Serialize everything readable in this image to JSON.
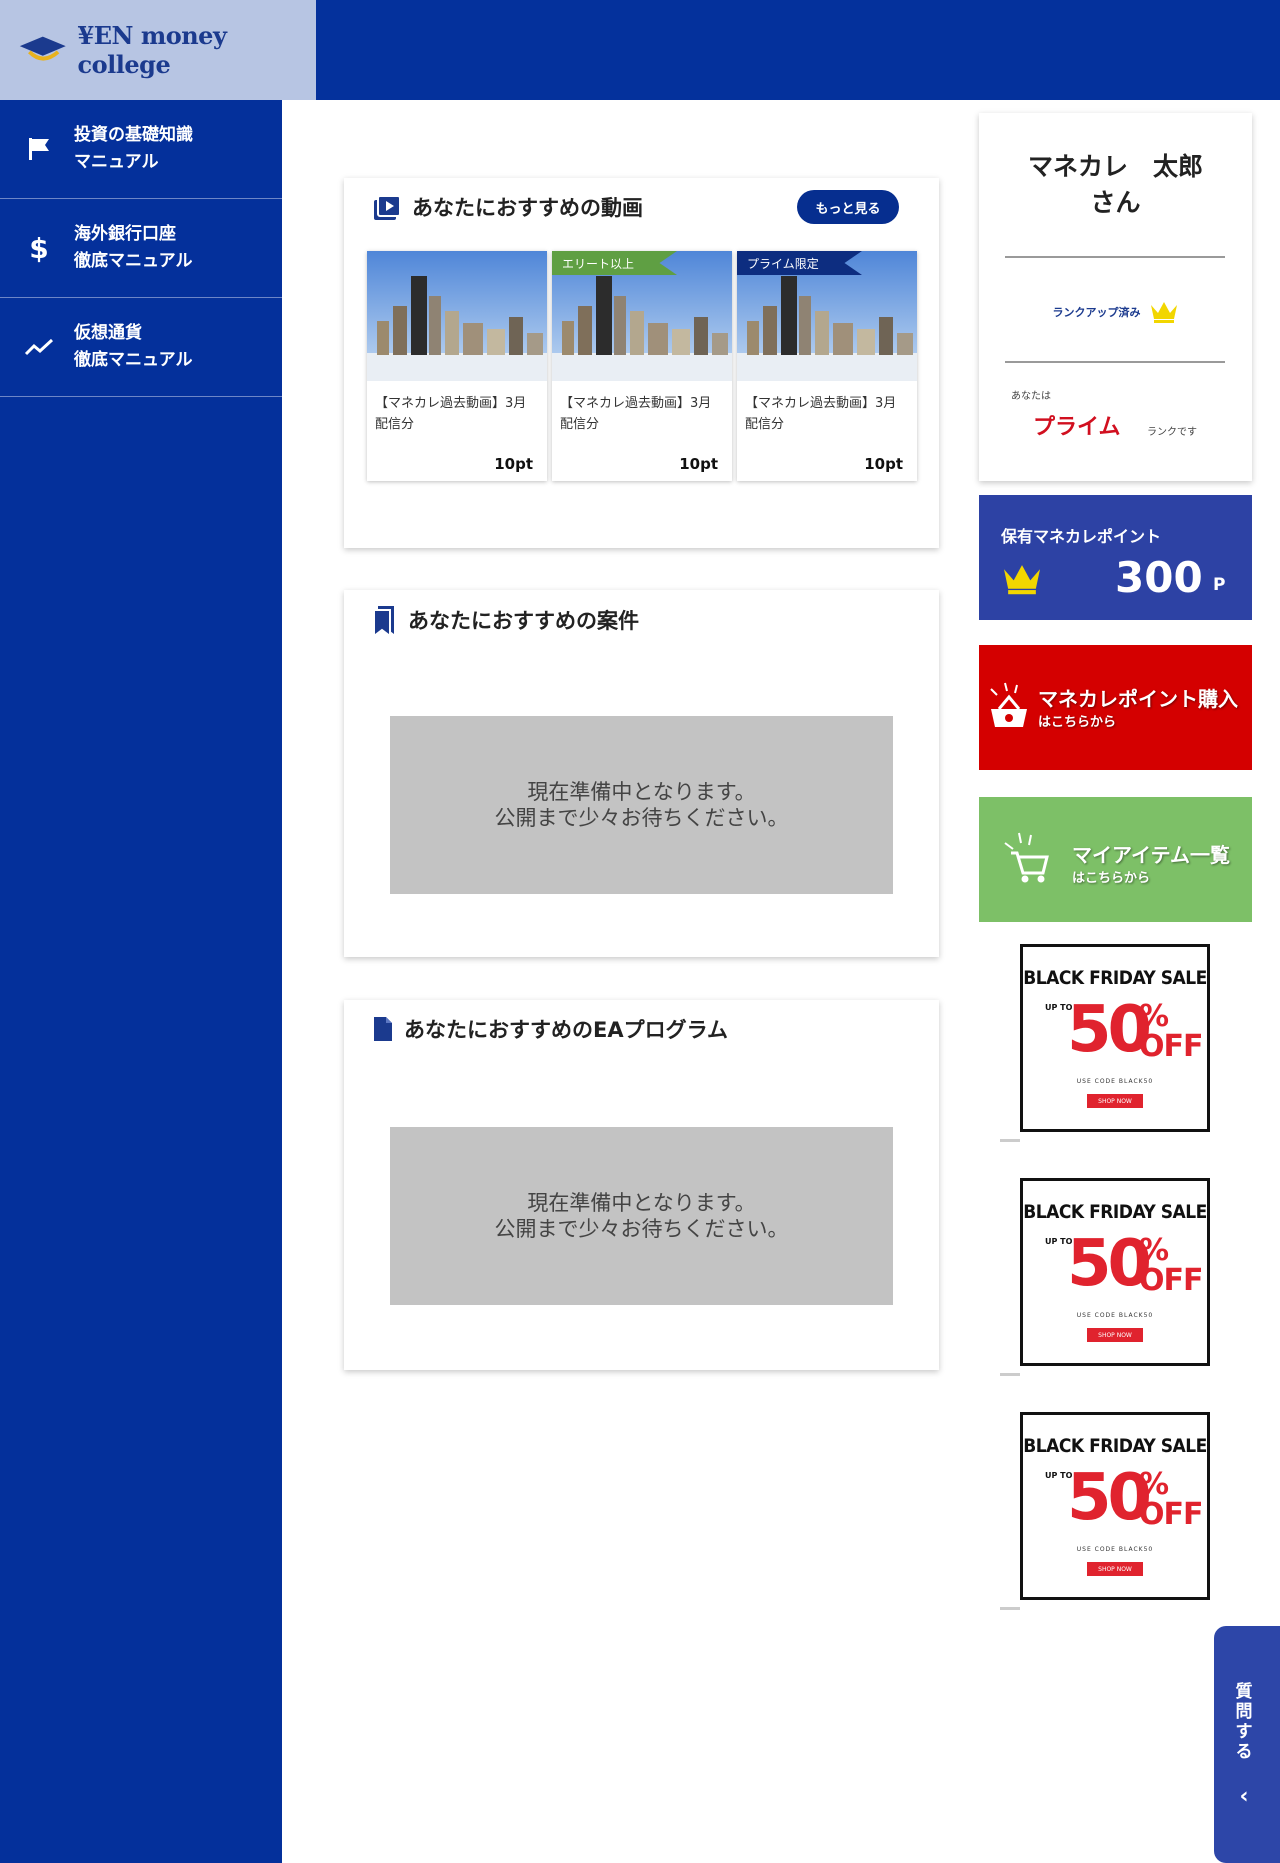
{
  "brand": {
    "logo_text": "¥EN money college"
  },
  "sidebar": {
    "items": [
      {
        "icon": "flag-icon",
        "label": "投資の基礎知識\nマニュアル"
      },
      {
        "icon": "dollar-icon",
        "label": "海外銀行口座\n徹底マニュアル"
      },
      {
        "icon": "trend-icon",
        "label": "仮想通貨\n徹底マニュアル"
      }
    ]
  },
  "videos_section": {
    "title": "あなたにおすすめの動画",
    "more_label": "もっと見る",
    "videos": [
      {
        "title": "【マネカレ過去動画】3月配信分",
        "points": "10pt",
        "ribbon": ""
      },
      {
        "title": "【マネカレ過去動画】3月配信分",
        "points": "10pt",
        "ribbon": "エリート以上"
      },
      {
        "title": "【マネカレ過去動画】3月配信分",
        "points": "10pt",
        "ribbon": "プライム限定"
      }
    ]
  },
  "deals_section": {
    "title": "あなたにおすすめの案件",
    "placeholder_line1": "現在準備中となります。",
    "placeholder_line2": "公開まで少々お待ちください。"
  },
  "ea_section": {
    "title": "あなたにおすすめのEAプログラム",
    "placeholder_line1": "現在準備中となります。",
    "placeholder_line2": "公開まで少々お待ちください。"
  },
  "profile": {
    "name": "マネカレ　太郎",
    "honorific": "さん",
    "rankup_label": "ランクアップ済み",
    "you_are": "あなたは",
    "rank": "プライム",
    "rank_suffix": "ランクです"
  },
  "points": {
    "label": "保有マネカレポイント",
    "value": "300",
    "unit": "P"
  },
  "promo_purchase": {
    "main": "マネカレポイント購入",
    "sub": "はこちらから"
  },
  "promo_items": {
    "main": "マイアイテム一覧",
    "sub": "はこちらから"
  },
  "banners": [
    {
      "title": "BLACK FRIDAY SALE",
      "upto": "UP TO",
      "value": "50",
      "pct": "%",
      "off": "OFF",
      "code": "USE CODE BLACK50",
      "shop": "SHOP NOW"
    },
    {
      "title": "BLACK FRIDAY SALE",
      "upto": "UP TO",
      "value": "50",
      "pct": "%",
      "off": "OFF",
      "code": "USE CODE BLACK50",
      "shop": "SHOP NOW"
    },
    {
      "title": "BLACK FRIDAY SALE",
      "upto": "UP TO",
      "value": "50",
      "pct": "%",
      "off": "OFF",
      "code": "USE CODE BLACK50",
      "shop": "SHOP NOW"
    }
  ],
  "ask_button": {
    "label": "質問する",
    "chevron": "‹"
  },
  "colors": {
    "primary": "#04309b",
    "accent_red": "#d40000",
    "accent_green": "#7dc067",
    "rank_red": "#d10f1f",
    "crown_gold": "#f2d600"
  }
}
